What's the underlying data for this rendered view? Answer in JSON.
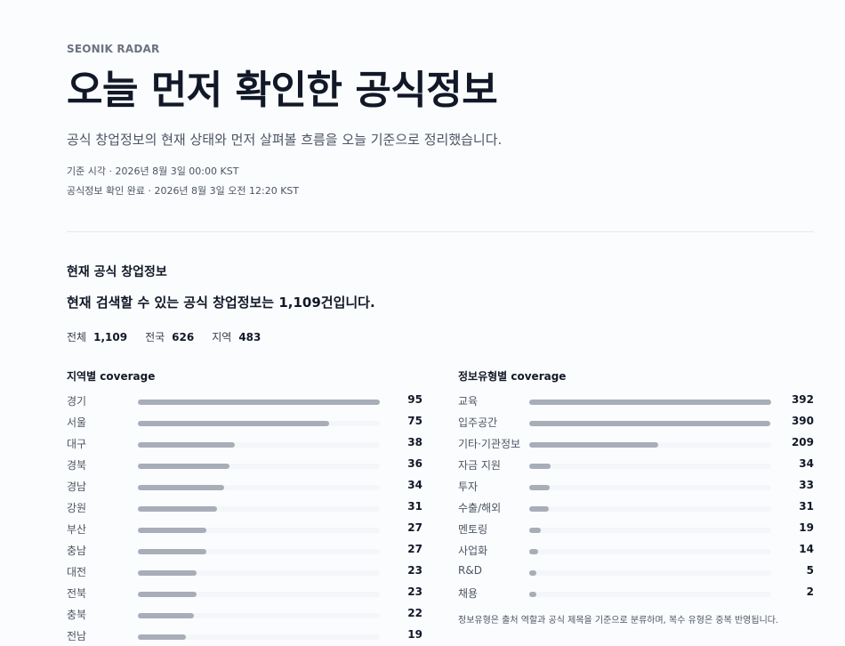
{
  "header": {
    "kicker": "SEONIK RADAR",
    "title": "오늘 먼저 확인한 공식정보",
    "subtitle": "공식 창업정보의 현재 상태와 먼저 살펴볼 흐름을 오늘 기준으로 정리했습니다.",
    "meta_1": "기준 시각 · 2026년 8월 3일 00:00 KST",
    "meta_2": "공식정보 확인 완료 · 2026년 8월 3일 오전 12:20 KST"
  },
  "summary": {
    "section_title": "현재 공식 창업정보",
    "headline": "현재 검색할 수 있는 공식 창업정보는 1,109건입니다.",
    "stats": [
      {
        "label": "전체",
        "value": "1,109"
      },
      {
        "label": "전국",
        "value": "626"
      },
      {
        "label": "지역",
        "value": "483"
      }
    ]
  },
  "region": {
    "title": "지역별 coverage",
    "max": 95,
    "items": [
      {
        "label": "경기",
        "value": 95
      },
      {
        "label": "서울",
        "value": 75
      },
      {
        "label": "대구",
        "value": 38
      },
      {
        "label": "경북",
        "value": 36
      },
      {
        "label": "경남",
        "value": 34
      },
      {
        "label": "강원",
        "value": 31
      },
      {
        "label": "부산",
        "value": 27
      },
      {
        "label": "충남",
        "value": 27
      },
      {
        "label": "대전",
        "value": 23
      },
      {
        "label": "전북",
        "value": 23
      },
      {
        "label": "충북",
        "value": 22
      },
      {
        "label": "전남",
        "value": 19
      }
    ]
  },
  "type": {
    "title": "정보유형별 coverage",
    "max": 392,
    "items": [
      {
        "label": "교육",
        "value": 392
      },
      {
        "label": "입주공간",
        "value": 390
      },
      {
        "label": "기타·기관정보",
        "value": 209
      },
      {
        "label": "자금 지원",
        "value": 34
      },
      {
        "label": "투자",
        "value": 33
      },
      {
        "label": "수출/해외",
        "value": 31
      },
      {
        "label": "멘토링",
        "value": 19
      },
      {
        "label": "사업화",
        "value": 14
      },
      {
        "label": "R&D",
        "value": 5
      },
      {
        "label": "채용",
        "value": 2
      }
    ],
    "note": "정보유형은 출처 역할과 공식 제목을 기준으로 분류하며, 복수 유형은 중복 반영됩니다."
  }
}
